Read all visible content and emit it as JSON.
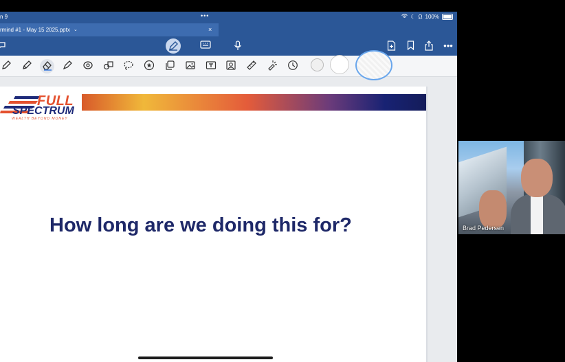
{
  "status_bar": {
    "time": "n 9",
    "dots": "•••",
    "battery": "100%"
  },
  "document_tab": {
    "title": "rmind #1 - May 15 2025.pptx",
    "chevron": "⌄",
    "close": "×"
  },
  "app_bar": {
    "icons": [
      "chat-icon",
      "pen-icon",
      "keyboard-icon",
      "microphone-icon",
      "add-page-icon",
      "bookmark-icon",
      "share-icon",
      "more-icon"
    ]
  },
  "toolbar": {
    "tools": [
      "pen-icon",
      "pencil-icon",
      "eraser-icon",
      "highlighter-icon",
      "shape-icon",
      "shapes-icon",
      "lasso-icon",
      "sticker-icon",
      "copy-icon",
      "image-icon",
      "text-box-icon",
      "photo-icon",
      "ruler-icon",
      "laser-pointer-icon",
      "history-icon"
    ]
  },
  "slide": {
    "logo_full": "FULL",
    "logo_spectrum": "SPECTRUM",
    "logo_tagline": "WEALTH BEYOND MONEY",
    "headline": "How long are we doing this for?"
  },
  "video": {
    "participant_name": "Brad Pedersen"
  },
  "colors": {
    "app_blue": "#2b5797",
    "headline_navy": "#1e2868",
    "brand_orange": "#e4512f"
  }
}
